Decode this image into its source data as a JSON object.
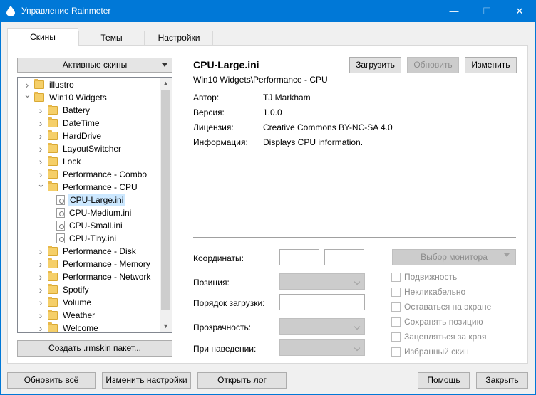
{
  "window": {
    "title": "Управление Rainmeter",
    "minimize": "—",
    "maximize": "☐",
    "close": "✕",
    "accent": "#0078d7"
  },
  "tabs": [
    {
      "label": "Скины",
      "active": true
    },
    {
      "label": "Темы",
      "active": false
    },
    {
      "label": "Настройки",
      "active": false
    }
  ],
  "left": {
    "active_skins_label": "Активные скины",
    "create_package_label": "Создать .rmskin пакет..."
  },
  "tree": [
    {
      "label": "illustro",
      "type": "folder",
      "level": 0,
      "expanded": false
    },
    {
      "label": "Win10 Widgets",
      "type": "folder",
      "level": 0,
      "expanded": true
    },
    {
      "label": "Battery",
      "type": "folder",
      "level": 1,
      "expanded": false
    },
    {
      "label": "DateTime",
      "type": "folder",
      "level": 1,
      "expanded": false
    },
    {
      "label": "HardDrive",
      "type": "folder",
      "level": 1,
      "expanded": false
    },
    {
      "label": "LayoutSwitcher",
      "type": "folder",
      "level": 1,
      "expanded": false
    },
    {
      "label": "Lock",
      "type": "folder",
      "level": 1,
      "expanded": false
    },
    {
      "label": "Performance - Combo",
      "type": "folder",
      "level": 1,
      "expanded": false
    },
    {
      "label": "Performance - CPU",
      "type": "folder",
      "level": 1,
      "expanded": true
    },
    {
      "label": "CPU-Large.ini",
      "type": "file",
      "level": 2,
      "selected": true
    },
    {
      "label": "CPU-Medium.ini",
      "type": "file",
      "level": 2
    },
    {
      "label": "CPU-Small.ini",
      "type": "file",
      "level": 2
    },
    {
      "label": "CPU-Tiny.ini",
      "type": "file",
      "level": 2
    },
    {
      "label": "Performance - Disk",
      "type": "folder",
      "level": 1,
      "expanded": false
    },
    {
      "label": "Performance - Memory",
      "type": "folder",
      "level": 1,
      "expanded": false
    },
    {
      "label": "Performance - Network",
      "type": "folder",
      "level": 1,
      "expanded": false
    },
    {
      "label": "Spotify",
      "type": "folder",
      "level": 1,
      "expanded": false
    },
    {
      "label": "Volume",
      "type": "folder",
      "level": 1,
      "expanded": false
    },
    {
      "label": "Weather",
      "type": "folder",
      "level": 1,
      "expanded": false
    },
    {
      "label": "Welcome",
      "type": "folder",
      "level": 1,
      "expanded": false
    }
  ],
  "skin": {
    "name": "CPU-Large.ini",
    "path": "Win10 Widgets\\Performance - CPU",
    "load_label": "Загрузить",
    "refresh_label": "Обновить",
    "edit_label": "Изменить",
    "author_label": "Автор:",
    "author": "TJ Markham",
    "version_label": "Версия:",
    "version": "1.0.0",
    "license_label": "Лицензия:",
    "license": "Creative Commons BY-NC-SA 4.0",
    "info_label": "Информация:",
    "info": "Displays CPU information."
  },
  "settings": {
    "coords_label": "Координаты:",
    "position_label": "Позиция:",
    "load_order_label": "Порядок загрузки:",
    "transparency_label": "Прозрачность:",
    "on_hover_label": "При наведении:",
    "monitor_label": "Выбор монитора",
    "checks": [
      "Подвижность",
      "Некликабельно",
      "Оставаться на экране",
      "Сохранять позицию",
      "Зацепляться за края",
      "Избранный скин"
    ]
  },
  "bottom": {
    "refresh_all": "Обновить всё",
    "edit_settings": "Изменить настройки",
    "open_log": "Открыть лог",
    "help": "Помощь",
    "close": "Закрыть"
  }
}
